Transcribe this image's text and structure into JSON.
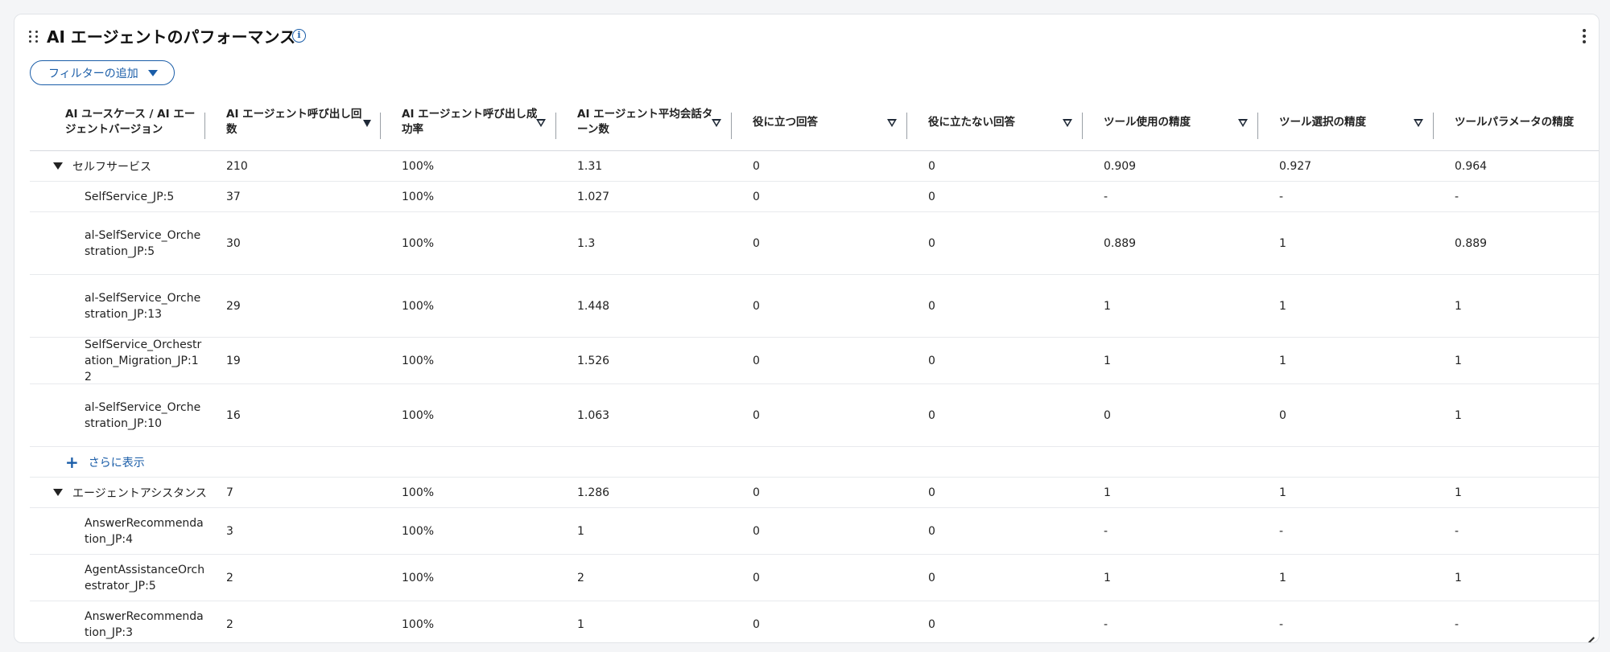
{
  "widget": {
    "title": "AI エージェントのパフォーマンス",
    "filter_label": "フィルターの追加"
  },
  "table": {
    "columns": [
      {
        "label": "AI ユースケース / AI エージェントバージョン",
        "sort": "none"
      },
      {
        "label": "AI エージェント呼び出し回数",
        "sort": "desc"
      },
      {
        "label": "AI エージェント呼び出し成功率",
        "sort": "unsorted"
      },
      {
        "label": "AI エージェント平均会話ターン数",
        "sort": "unsorted"
      },
      {
        "label": "役に立つ回答",
        "sort": "unsorted"
      },
      {
        "label": "役に立たない回答",
        "sort": "unsorted"
      },
      {
        "label": "ツール使用の精度",
        "sort": "unsorted"
      },
      {
        "label": "ツール選択の精度",
        "sort": "unsorted"
      },
      {
        "label": "ツールパラメータの精度",
        "sort": "none"
      }
    ],
    "groups": [
      {
        "name": "セルフサービス",
        "values": [
          "210",
          "100%",
          "1.31",
          "0",
          "0",
          "0.909",
          "0.927",
          "0.964"
        ],
        "rows": [
          {
            "name": "SelfService_JP:5",
            "values": [
              "37",
              "100%",
              "1.027",
              "0",
              "0",
              "-",
              "-",
              "-"
            ]
          },
          {
            "name": "al-SelfService_Orchestration_JP:5",
            "values": [
              "30",
              "100%",
              "1.3",
              "0",
              "0",
              "0.889",
              "1",
              "0.889"
            ]
          },
          {
            "name": "al-SelfService_Orchestration_JP:13",
            "values": [
              "29",
              "100%",
              "1.448",
              "0",
              "0",
              "1",
              "1",
              "1"
            ]
          },
          {
            "name": "SelfService_Orchestration_Migration_JP:12",
            "values": [
              "19",
              "100%",
              "1.526",
              "0",
              "0",
              "1",
              "1",
              "1"
            ]
          },
          {
            "name": "al-SelfService_Orchestration_JP:10",
            "values": [
              "16",
              "100%",
              "1.063",
              "0",
              "0",
              "0",
              "0",
              "1"
            ]
          }
        ],
        "show_more_label": "さらに表示"
      },
      {
        "name": "エージェントアシスタンス",
        "values": [
          "7",
          "100%",
          "1.286",
          "0",
          "0",
          "1",
          "1",
          "1"
        ],
        "rows": [
          {
            "name": "AnswerRecommendation_JP:4",
            "values": [
              "3",
              "100%",
              "1",
              "0",
              "0",
              "-",
              "-",
              "-"
            ]
          },
          {
            "name": "AgentAssistanceOrchestrator_JP:5",
            "values": [
              "2",
              "100%",
              "2",
              "0",
              "0",
              "1",
              "1",
              "1"
            ]
          },
          {
            "name": "AnswerRecommendation_JP:3",
            "values": [
              "2",
              "100%",
              "1",
              "0",
              "0",
              "-",
              "-",
              "-"
            ]
          }
        ]
      }
    ]
  }
}
